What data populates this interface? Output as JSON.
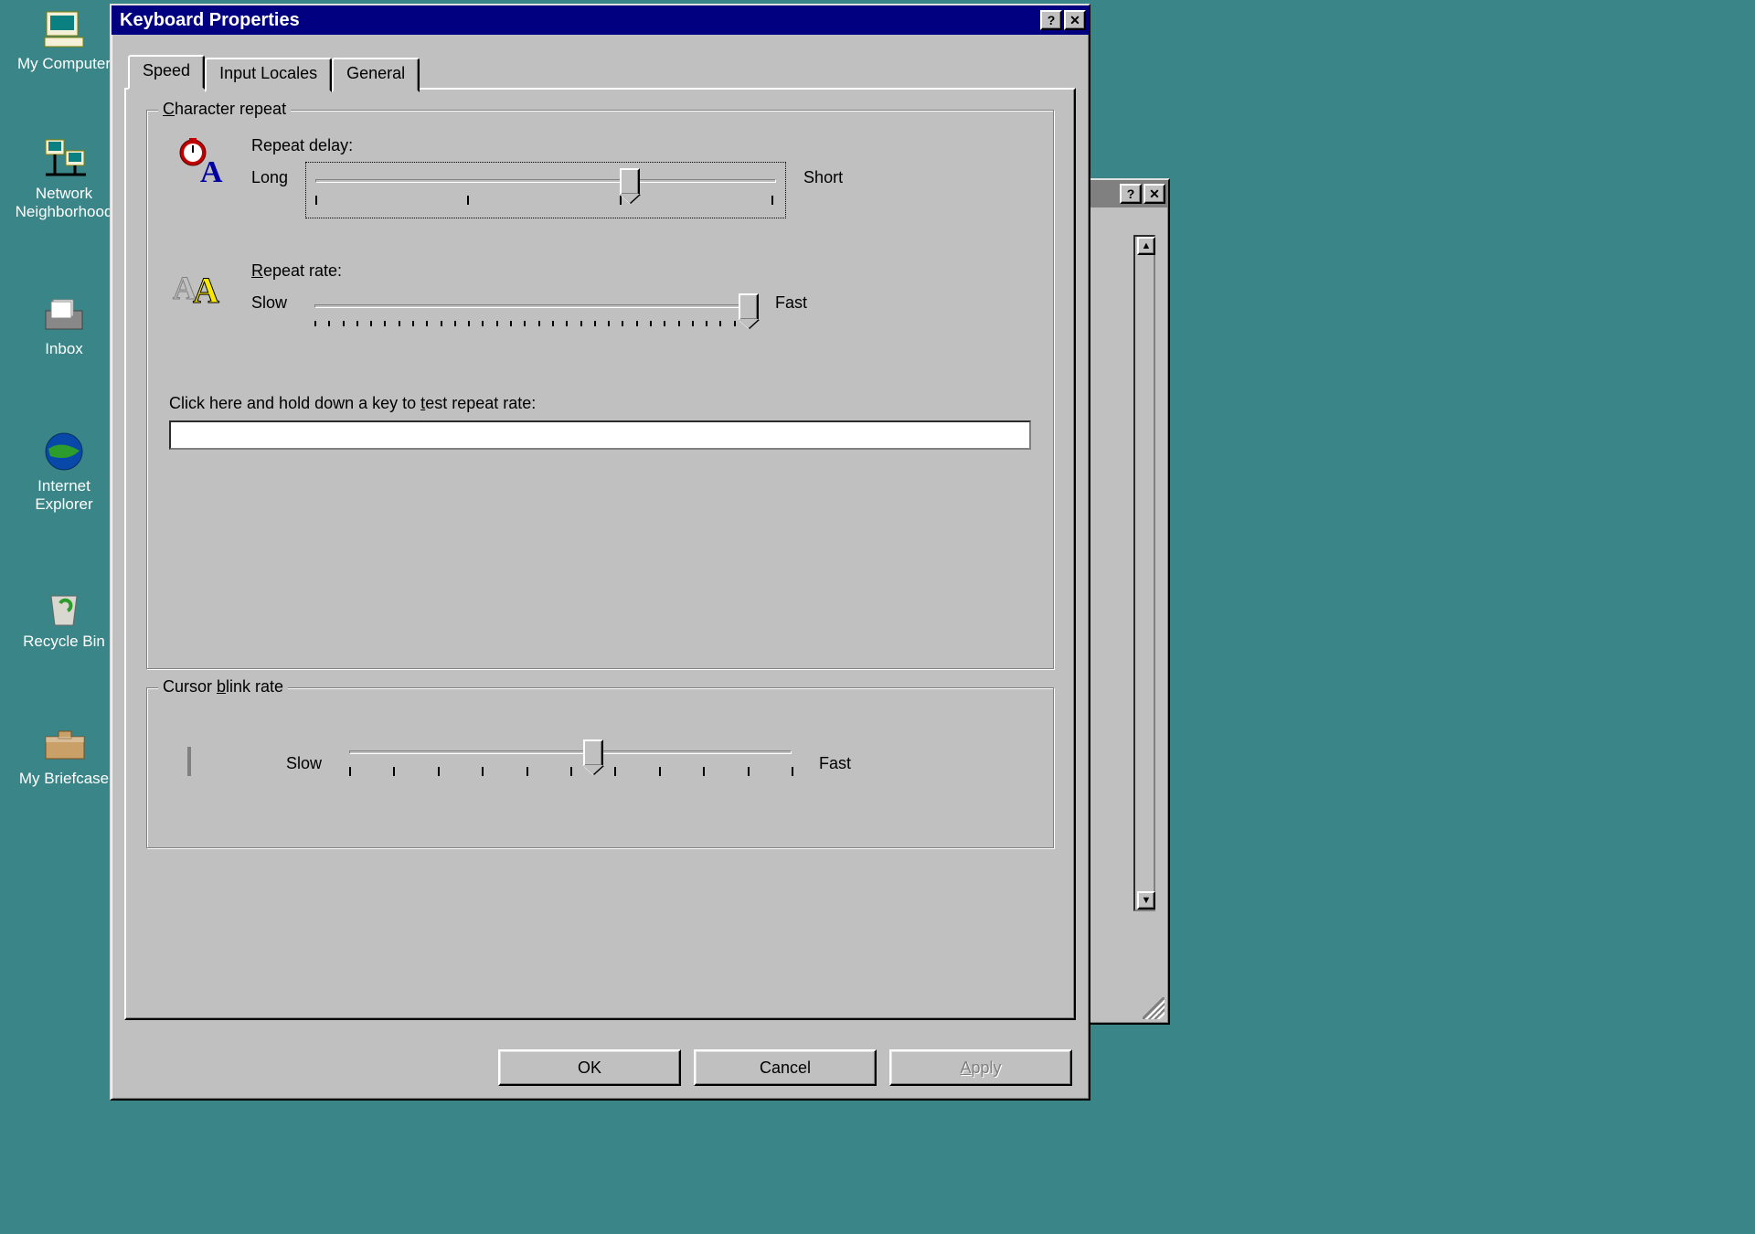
{
  "desktop": {
    "icons": [
      {
        "label": "My Computer"
      },
      {
        "label": "Network Neighborhood"
      },
      {
        "label": "Inbox"
      },
      {
        "label": "Internet Explorer"
      },
      {
        "label": "Recycle Bin"
      },
      {
        "label": "My Briefcase"
      }
    ]
  },
  "dialog": {
    "title": "Keyboard Properties",
    "tabs": [
      "Speed",
      "Input Locales",
      "General"
    ],
    "active_tab": 0,
    "group_char": {
      "legend": "Character repeat",
      "delay": {
        "title": "Repeat delay:",
        "left": "Long",
        "right": "Short",
        "ticks": 4,
        "value": 2
      },
      "rate": {
        "title": "Repeat rate:",
        "left": "Slow",
        "right": "Fast",
        "ticks": 32,
        "value": 31
      },
      "test_label": "Click here and hold down a key to test repeat rate:",
      "test_value": ""
    },
    "group_blink": {
      "legend": "Cursor blink rate",
      "left": "Slow",
      "right": "Fast",
      "ticks": 11,
      "value": 5
    },
    "buttons": {
      "ok": "OK",
      "cancel": "Cancel",
      "apply": "Apply"
    }
  },
  "bgwin": {
    "help": "?",
    "close": "✕",
    "up": "▲",
    "down": "▼"
  }
}
